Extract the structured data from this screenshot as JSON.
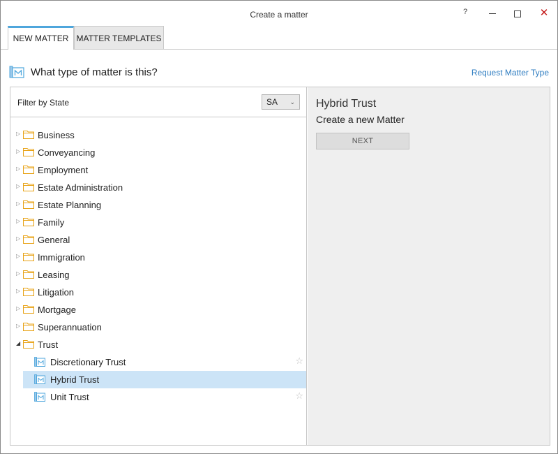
{
  "window": {
    "title": "Create a matter",
    "help_glyph": "?",
    "close_glyph": "✕"
  },
  "tabs": [
    {
      "label": "NEW MATTER",
      "active": true
    },
    {
      "label": "MATTER TEMPLATES",
      "active": false
    }
  ],
  "header": {
    "question": "What type of matter is this?",
    "request_link": "Request Matter Type"
  },
  "filter": {
    "label": "Filter by State",
    "selected_state": "SA"
  },
  "tree": {
    "categories": [
      {
        "label": "Business",
        "expanded": false
      },
      {
        "label": "Conveyancing",
        "expanded": false
      },
      {
        "label": "Employment",
        "expanded": false
      },
      {
        "label": "Estate Administration",
        "expanded": false
      },
      {
        "label": "Estate Planning",
        "expanded": false
      },
      {
        "label": "Family",
        "expanded": false
      },
      {
        "label": "General",
        "expanded": false
      },
      {
        "label": "Immigration",
        "expanded": false
      },
      {
        "label": "Leasing",
        "expanded": false
      },
      {
        "label": "Litigation",
        "expanded": false
      },
      {
        "label": "Mortgage",
        "expanded": false
      },
      {
        "label": "Superannuation",
        "expanded": false
      },
      {
        "label": "Trust",
        "expanded": true
      }
    ],
    "trust_children": [
      {
        "label": "Discretionary Trust",
        "selected": false
      },
      {
        "label": "Hybrid Trust",
        "selected": true
      },
      {
        "label": "Unit Trust",
        "selected": false
      }
    ]
  },
  "detail": {
    "title": "Hybrid Trust",
    "subtitle": "Create a new Matter",
    "next_label": "NEXT"
  },
  "colors": {
    "accent_tab": "#4ea6dc",
    "link": "#2f7dc1",
    "selection": "#cce4f7",
    "folder": "#e8a317",
    "close": "#c41a1a"
  }
}
